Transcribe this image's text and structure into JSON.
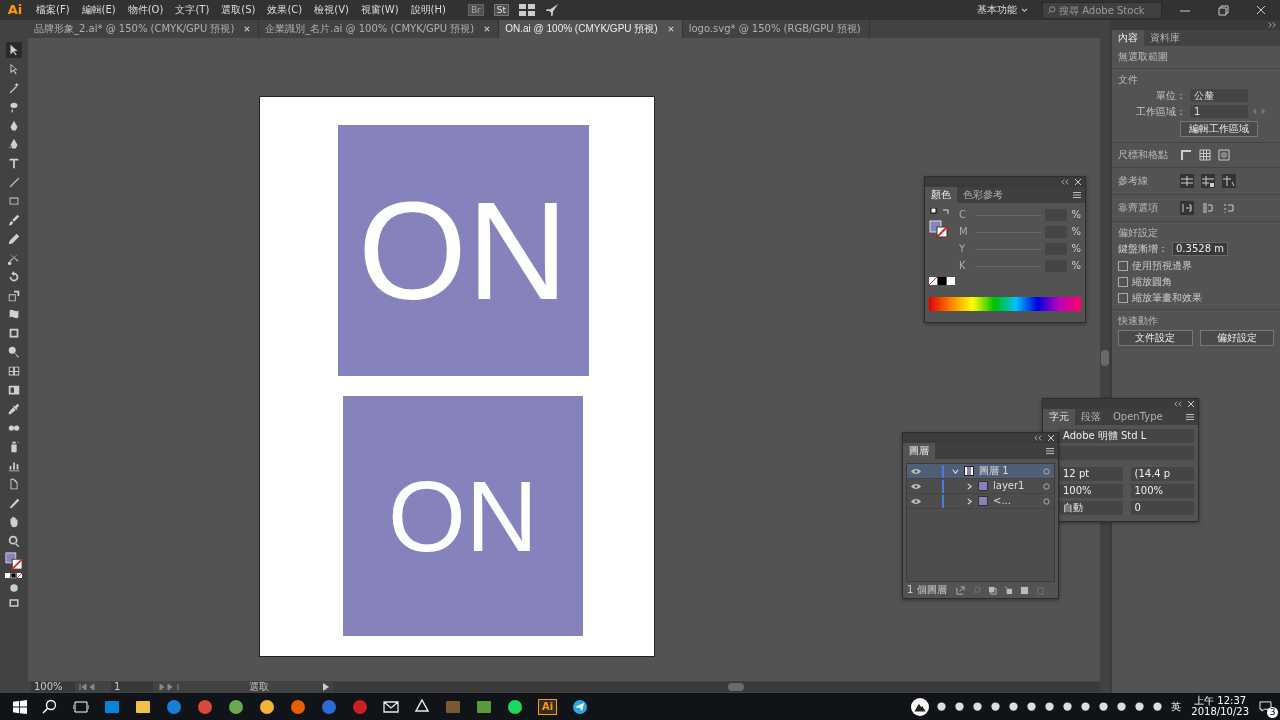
{
  "app": {
    "logo": "Ai",
    "menu": [
      "檔案(F)",
      "編輯(E)",
      "物件(O)",
      "文字(T)",
      "選取(S)",
      "效果(C)",
      "檢視(V)",
      "視窗(W)",
      "說明(H)"
    ],
    "bridge": "Br",
    "stock": "St",
    "workspace": "基本功能",
    "search": {
      "placeholder": "搜尋 Adobe Stock"
    }
  },
  "tabs": [
    {
      "label": "品牌形象_2.ai* @ 150% (CMYK/GPU 預視)",
      "selected": false
    },
    {
      "label": "企業識別_名片.ai @ 100% (CMYK/GPU 預視)",
      "selected": false
    },
    {
      "label": "ON.ai @ 100% (CMYK/GPU 預視)",
      "selected": true
    },
    {
      "label": "logo.svg* @ 150% (RGB/GPU 預視)",
      "selected": false
    }
  ],
  "artboard": {
    "objects": [
      {
        "text": "ON"
      },
      {
        "text": "ON"
      }
    ]
  },
  "properties_panel": {
    "tabs": [
      {
        "label": "內容",
        "selected": true
      },
      {
        "label": "資料庫",
        "selected": false
      }
    ],
    "selection": "無選取範圍",
    "document_heading": "文件",
    "units": {
      "label": "單位：",
      "value": "公釐"
    },
    "artboard": {
      "label": "工作區域：",
      "value": "1"
    },
    "edit_artboards": "編輯工作區域",
    "rulers_label": "尺標和格點",
    "guides_label": "參考線",
    "snap_label": "靠齊選項",
    "prefs_heading": "偏好設定",
    "keyboard_increment": {
      "label": "鍵盤漸增：",
      "value": "0.3528 m"
    },
    "options": [
      {
        "label": "使用預視邊界",
        "checked": false
      },
      {
        "label": "縮放圓角",
        "checked": false
      },
      {
        "label": "縮放筆畫和效果",
        "checked": false
      }
    ],
    "quick_heading": "快速動作",
    "buttons": [
      "文件設定",
      "偏好設定"
    ]
  },
  "color_panel": {
    "tabs": [
      {
        "label": "顏色",
        "selected": true
      },
      {
        "label": "色彩參考",
        "selected": false
      }
    ],
    "channels": [
      {
        "name": "C",
        "unit": "%"
      },
      {
        "name": "M",
        "unit": "%"
      },
      {
        "name": "Y",
        "unit": "%"
      },
      {
        "name": "K",
        "unit": "%"
      }
    ]
  },
  "layers_panel": {
    "title": "圖層",
    "rows": [
      {
        "name": "圖層 1",
        "expanded": true,
        "selected": true,
        "children": [
          {
            "name": "layer1",
            "expanded": false,
            "selected": false
          },
          {
            "name": "<...",
            "expanded": false,
            "selected": false
          }
        ]
      }
    ],
    "footer": "1 個圖層"
  },
  "character_panel": {
    "tabs": [
      {
        "label": "字元",
        "selected": true
      },
      {
        "label": "段落",
        "selected": false
      },
      {
        "label": "OpenType",
        "selected": false
      }
    ],
    "font_family": "Adobe 明體 Std L",
    "font_size": "12 pt",
    "leading": "(14.4 p",
    "vertical_scale": "100%",
    "horizontal_scale": "100%",
    "kerning": "自動",
    "tracking": "0"
  },
  "status_bar": {
    "zoom": "100%",
    "artboard": "1",
    "tool": "選取"
  },
  "taskbar": {
    "active_app": "Ai",
    "input_language": "英",
    "time": "上午 12:37",
    "date": "2018/10/23",
    "notifications": "3"
  }
}
